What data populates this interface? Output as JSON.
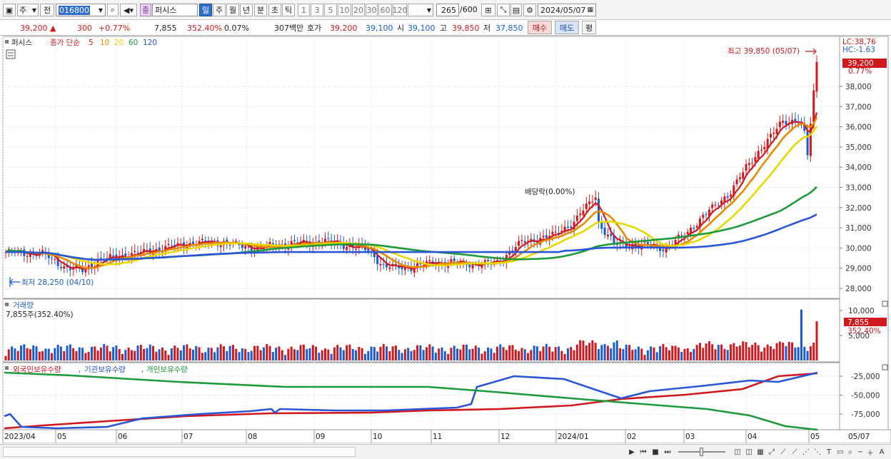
{
  "toolbar": {
    "market": "주",
    "mode": "전",
    "code": "016800",
    "stock_type": "종",
    "stock_name": "퍼시스",
    "periods": [
      "일",
      "주",
      "월",
      "년",
      "분",
      "초",
      "틱"
    ],
    "period_selected": "일",
    "minutes": [
      "1",
      "3",
      "5",
      "10",
      "20",
      "30",
      "60",
      "120"
    ],
    "count": "265",
    "count_total": "/600",
    "date": "2024/05/07"
  },
  "quote": {
    "price": "39,200",
    "change_arrow": "▲",
    "change": "300",
    "change_pct": "+0.77%",
    "volume": "7,855",
    "volume_ratio": "352.40%",
    "turnover_pct": "0.07%",
    "amount": "307백만",
    "hoga_label": "호가",
    "ask": "39,200",
    "bid": "39,100",
    "open_label": "시",
    "open": "39,100",
    "high_label": "고",
    "high": "39,850",
    "low_label": "저",
    "low": "37,850",
    "buy_label": "매수",
    "sell_label": "매도",
    "eval_label": "평"
  },
  "price_panel": {
    "title": "퍼시스",
    "ma_label": "종가 단순",
    "ma_periods": [
      "5",
      "10",
      "20",
      "60",
      "120"
    ],
    "ma_colors": [
      "#d0191e",
      "#e68a00",
      "#e8d800",
      "#1e9a3a",
      "#2a55d8"
    ],
    "lc": "LC:38,76",
    "hc": "HC:-1.63",
    "last_price": "39,200",
    "last_pct": "0.77%",
    "high_note": "최고 39,850 (05/07)",
    "low_note": "최저 28,250 (04/10)",
    "dividend_note": "배당락(0.00%)",
    "y_ticks": [
      "38,000",
      "37,000",
      "36,000",
      "35,000",
      "34,000",
      "33,000",
      "32,000",
      "31,000",
      "30,000",
      "29,000",
      "28,000"
    ]
  },
  "volume_panel": {
    "title": "거래량",
    "sub": "7,855주(352.40%)",
    "last": "7,855",
    "last_pct": "352.40%",
    "y_ticks": [
      "10,000",
      "5,000"
    ]
  },
  "holding_panel": {
    "legend": [
      "외국인보유수량",
      "기관보유수량",
      "개인보유수량"
    ],
    "colors": [
      "#d0191e",
      "#2a55d8",
      "#1e9a3a"
    ],
    "y_ticks": [
      "-25,000",
      "-50,000",
      "-75,000"
    ]
  },
  "x_axis": [
    "2023/04",
    "05",
    "06",
    "07",
    "08",
    "09",
    "10",
    "11",
    "12",
    "2024/01",
    "02",
    "03",
    "04",
    "05",
    "05/07"
  ],
  "colors": {
    "up": "#d0191e",
    "down": "#1a5bd0",
    "accent": "#2f6fd0"
  }
}
